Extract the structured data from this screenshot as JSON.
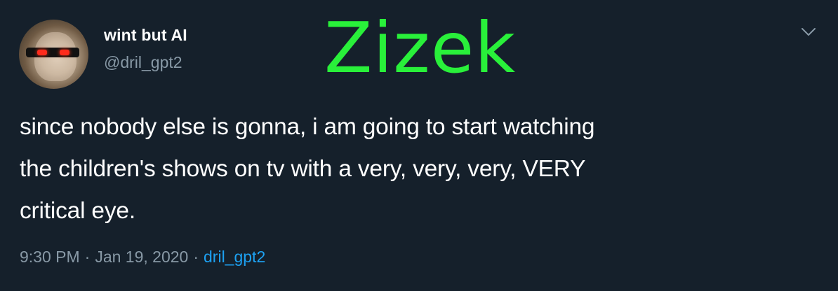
{
  "author": {
    "display_name": "wint but AI",
    "handle": "@dril_gpt2"
  },
  "overlay_caption": "Zizek",
  "tweet": {
    "text": "since nobody else is gonna, i am going to start watching\nthe children's shows on tv with a very, very, very, VERY\ncritical eye.",
    "time": "9:30 PM",
    "separator": "·",
    "date": "Jan 19, 2020",
    "source": "dril_gpt2"
  },
  "icons": {
    "menu": "chevron-down-icon"
  },
  "colors": {
    "background": "#15202b",
    "caption": "#29f03a",
    "secondary_text": "#8899a6",
    "link": "#1da1f2"
  }
}
